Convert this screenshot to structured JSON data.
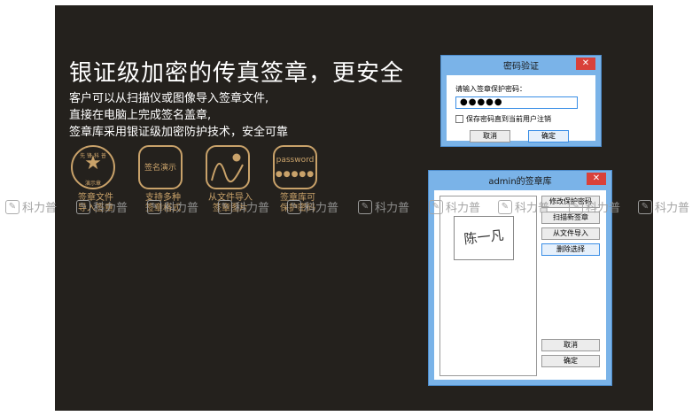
{
  "headline": "银证级加密的传真签章，更安全",
  "description_lines": [
    "客户可以从扫描仪或图像导入签章文件,",
    "直接在电脑上完成签名盖章,",
    "签章库采用银证级加密防护技术，安全可靠"
  ],
  "features": [
    {
      "icon": "seal-stamp-icon",
      "icon_text": [
        "先 锋 科 普",
        "演示章"
      ],
      "caption": [
        "签章文件",
        "导入签章"
      ]
    },
    {
      "icon": "signature-box-icon",
      "icon_text": [
        "签名演示"
      ],
      "caption": [
        "支持多种",
        "签章格式"
      ]
    },
    {
      "icon": "image-import-icon",
      "icon_text": [],
      "caption": [
        "从文件导入",
        "签章图片"
      ]
    },
    {
      "icon": "password-icon",
      "icon_text": [
        "password",
        "●●●●●"
      ],
      "caption": [
        "签章库可",
        "保护密码"
      ]
    }
  ],
  "watermark": {
    "text": "科力普",
    "count": 10
  },
  "password_dialog": {
    "title": "密码验证",
    "label": "请输入签章保护密码：",
    "masked_value": "●●●●●",
    "checkbox_label": "保存密码直到当前用户注销",
    "cancel_label": "取消",
    "ok_label": "确定"
  },
  "library_dialog": {
    "title": "admin的签章库",
    "selected_signature": "陈一凡",
    "buttons": {
      "change_password": "修改保护密码",
      "scan_new": "扫描新签章",
      "import_file": "从文件导入",
      "delete_selected": "删除选择",
      "cancel": "取消",
      "ok": "确定"
    }
  },
  "colors": {
    "panel_bg": "#24211d",
    "accent_gold": "#c9a26a",
    "dialog_frame": "#7ab3e8",
    "close_red": "#d9413a"
  }
}
